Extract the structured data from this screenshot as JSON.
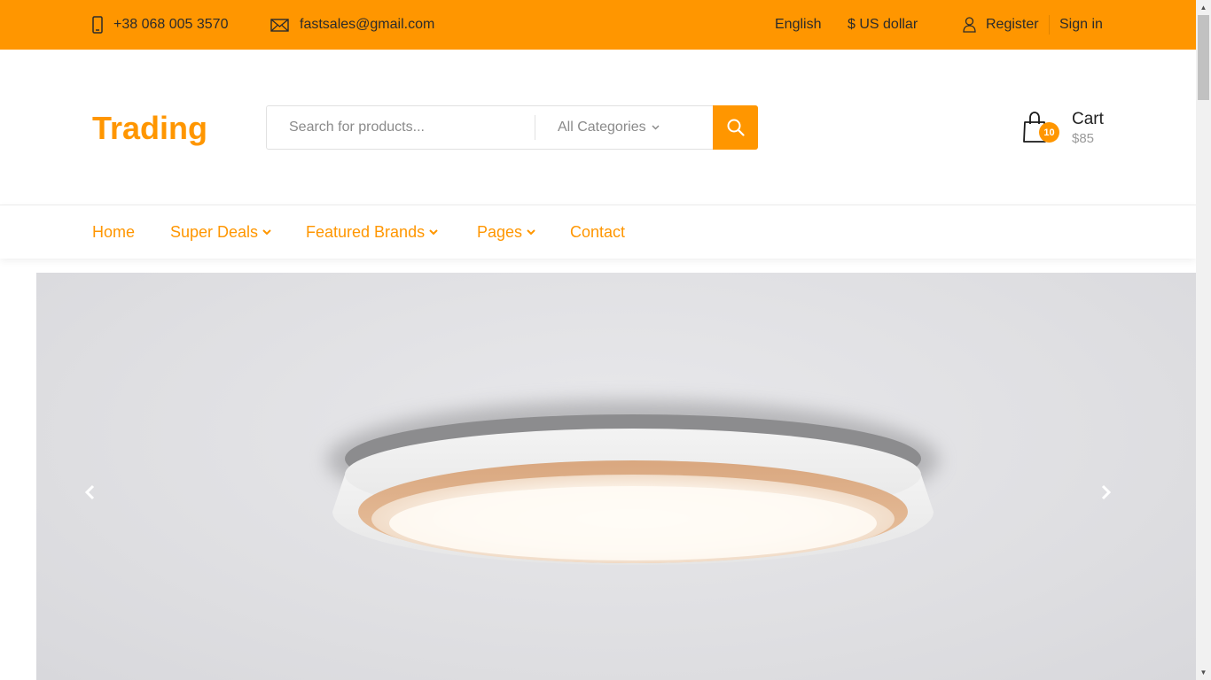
{
  "topbar": {
    "phone": "+38 068 005 3570",
    "email": "fastsales@gmail.com",
    "language": "English",
    "currency": "$ US dollar",
    "register": "Register",
    "sign_in": "Sign in",
    "icons": {
      "phone": "mobile-phone-icon",
      "email": "envelope-icon",
      "user": "user-icon"
    }
  },
  "header": {
    "logo": "Trading",
    "search": {
      "placeholder": "Search for products...",
      "category": "All Categories",
      "button_icon": "search-icon"
    },
    "cart": {
      "label": "Cart",
      "count": "10",
      "total": "$85",
      "icon": "shopping-bag-icon"
    }
  },
  "nav": {
    "items": [
      {
        "label": "Home",
        "dropdown": false
      },
      {
        "label": "Super Deals",
        "dropdown": true
      },
      {
        "label": "Featured Brands",
        "dropdown": true
      },
      {
        "label": "Pages",
        "dropdown": true
      },
      {
        "label": "Contact",
        "dropdown": false
      }
    ]
  },
  "hero": {
    "image": "ceiling-lamp-photo",
    "prev_icon": "chevron-left-icon",
    "next_icon": "chevron-right-icon"
  },
  "colors": {
    "accent": "#ff9600",
    "topbar_text": "#2b2b2b",
    "muted_text": "#8a8a8a",
    "hero_bg": "#e2e2e5"
  }
}
